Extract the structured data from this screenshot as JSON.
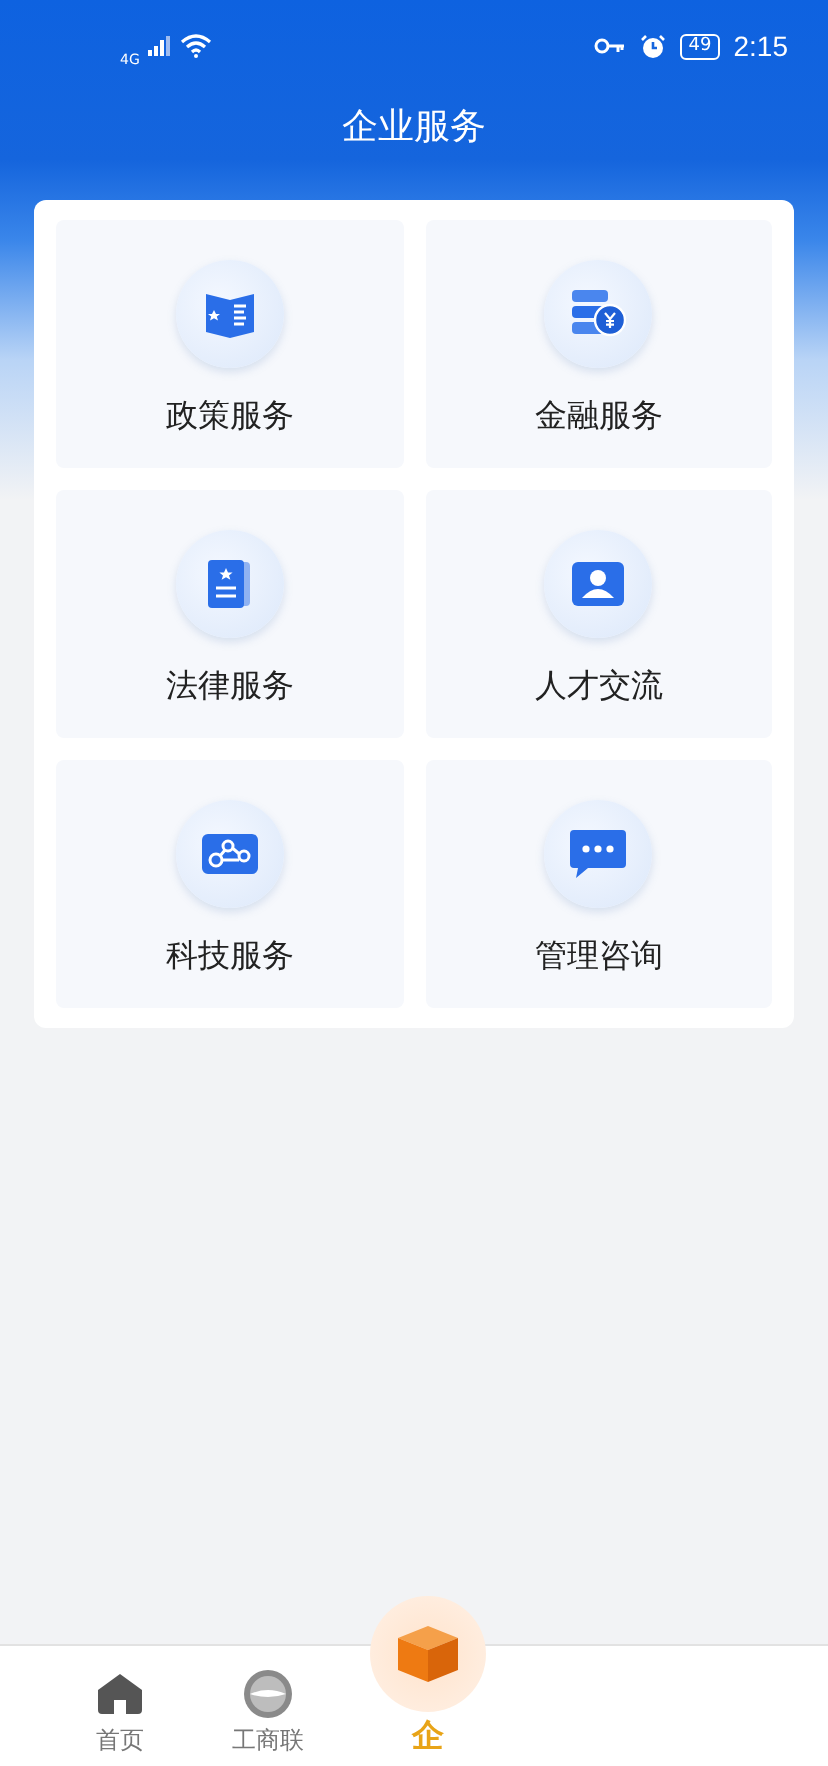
{
  "status_bar": {
    "network": "4G",
    "battery": "49",
    "time": "2:15"
  },
  "header": {
    "title": "企业服务"
  },
  "services": [
    {
      "label": "政策服务",
      "kind": "book"
    },
    {
      "label": "金融服务",
      "kind": "finance"
    },
    {
      "label": "法律服务",
      "kind": "document"
    },
    {
      "label": "人才交流",
      "kind": "person"
    },
    {
      "label": "科技服务",
      "kind": "nodes"
    },
    {
      "label": "管理咨询",
      "kind": "chat"
    }
  ],
  "tab_bar": [
    {
      "label": "首页",
      "kind": "home",
      "selected": false
    },
    {
      "label": "工商联",
      "kind": "emblem",
      "selected": false
    },
    {
      "label": "企",
      "kind": "box",
      "selected": true
    }
  ]
}
